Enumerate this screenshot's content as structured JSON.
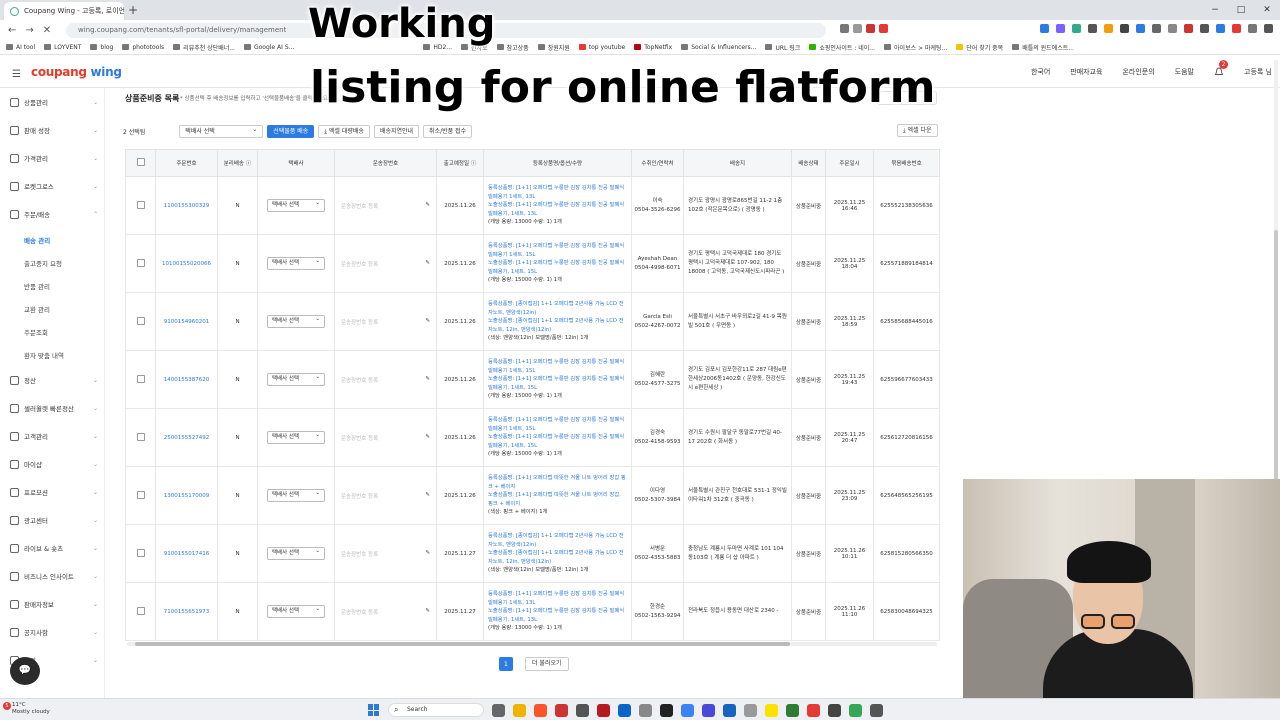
{
  "browser": {
    "tab_title": "Coupang Wing - 고등록, 로이언",
    "tab_close": "×",
    "new_tab": "+",
    "address": "wing.coupang.com/tenants/sfl-portal/delivery/management",
    "nav": [
      "←",
      "→",
      "✕"
    ],
    "window_controls": [
      "−",
      "□",
      "✕"
    ],
    "bookmarks": [
      "AI tool",
      "LOYVENT",
      "blog",
      "phototools",
      "리뷰추천 상단배너...",
      "Google AI S...",
      "HD2...",
      "한자로",
      "참고상품",
      "창원지원",
      "top youtube",
      "TopNetfix",
      "Social & Influencers...",
      "URL 링크",
      "쇼핑인사이트 : 네이...",
      "아이보스 > 마케팅...",
      "단어 찾기 중복",
      "배틀의 윈드에스트..."
    ]
  },
  "app": {
    "menu_icon": "☰",
    "logo_a": "coupang",
    "logo_b": "wing",
    "header_right": [
      "한국어",
      "판매자교육",
      "온라인문의",
      "도움말"
    ],
    "notification_count": "2",
    "user": "고등록 님"
  },
  "sidebar": {
    "items": [
      {
        "label": "상품관리"
      },
      {
        "label": "판매 성장"
      },
      {
        "label": "가격관리"
      },
      {
        "label": "로켓그로스"
      },
      {
        "label": "주문/배송"
      },
      {
        "label": "정산"
      },
      {
        "label": "셀러월렛 빠른정산"
      },
      {
        "label": "고객관리"
      },
      {
        "label": "마이샵"
      },
      {
        "label": "프로모션"
      },
      {
        "label": "광고센터"
      },
      {
        "label": "라이브 & 숏츠"
      },
      {
        "label": "비즈니스 인사이트"
      },
      {
        "label": "판매자정보"
      },
      {
        "label": "공지사항"
      },
      {
        "label": "문의"
      }
    ],
    "subitems": [
      "배송 관리",
      "출고중지 요청",
      "반품 관리",
      "교환 관리",
      "주문조회",
      "환자 맞춤 내역"
    ],
    "chat_icon": "💬"
  },
  "main": {
    "title": "상품준비중 목록",
    "description": "* 상품선택 후 배송정보를 입력하고 '선택물품배송'을 클릭하세요.",
    "close_label": "기",
    "selected_count": "2 선택됨",
    "carrier_select": "택배사 선택",
    "buttons": [
      "선택물품 배송",
      "⤓ 엑셀 대량배송",
      "배송지연안내",
      "취소/반품 접수"
    ],
    "excel_download": "⤓ 엑셀 다운",
    "columns": [
      "",
      "주문번호",
      "분리배송 ⓘ",
      "택배사",
      "운송장번호",
      "출고예정일 ⓘ",
      "등록상품명/옵션/수량",
      "수취인/연락처",
      "배송지",
      "배송상태",
      "주문일시",
      "묶음배송번호"
    ],
    "tracking_placeholder": "운송장번호 등록",
    "pen_icon": "✎",
    "rows": [
      {
        "order_no": "1100155300329",
        "split": "N",
        "carrier": "택배사 선택",
        "ship_date": "2025.11.26",
        "product": "등록상품명: [1+1] 오메다랩 누룽판 김장 김치통 진공 밀폐식 밀폐용기 1세트, 13L",
        "exposure": "노출상품명: [1+1] 오메다랩 누룽판 김장 김치통 진공 밀폐식 밀폐용기, 1세트, 13L",
        "option": "(개당 용량: 13000 수량: 1) 1개",
        "receiver": "이숙",
        "phone": "0504-3526-6296",
        "address": "경기도 광명시 광명로865번길 11-2 1층 102호 (작은문목으로) ( 광명동 )",
        "status": "상품준비중",
        "order_time": "2025.11.25 16:46",
        "bundle_no": "625552138305636"
      },
      {
        "order_no": "10100155020066",
        "split": "N",
        "carrier": "택배사 선택",
        "ship_date": "2025.11.26",
        "product": "등록상품명: [1+1] 오메다랩 누룽판 김장 김치통 진공 밀폐식 밀폐용기 1세트, 15L",
        "exposure": "노출상품명: [1+1] 오메다랩 누룽판 김장 김치통 진공 밀폐식 밀폐용기, 1세트, 15L",
        "option": "(개당 용량: 15000 수량: 1) 1개",
        "receiver": "Ayeshah Dean",
        "phone": "0504-4998-6071",
        "address": "경기도 평택시 고덕국제대로 180 경기도 평택시 고덕국제대로 107-902, 180 18008 ( 고덕동, 고덕국제신도시파라곤 )",
        "status": "상품준비중",
        "order_time": "2025.11.25 18:04",
        "bundle_no": "625571889184814"
      },
      {
        "order_no": "9100154960201",
        "split": "N",
        "carrier": "택배사 선택",
        "ship_date": "2025.11.26",
        "product": "등록상품명: [종이접김] 1+1 오메다랩 2년사용 가능 LCD 전자노트, 맨양색(12in)",
        "exposure": "노출상품명: [종이접김] 1+1 오메다랩 2년사용 가능 LCD 전자노트, 12in, 맨양색(12in)",
        "option": "(색상: 맨양색(12in) 모델명/품번: 12in) 1개",
        "receiver": "Garcia Esli",
        "phone": "0502-4267-0072",
        "address": "서울특별시 서초구 바우뫼로2길 41-9 목원빌 501호 ( 우면동 )",
        "status": "상품준비중",
        "order_time": "2025.11.25 18:59",
        "bundle_no": "625585688445016"
      },
      {
        "order_no": "1400155387620",
        "split": "N",
        "carrier": "택배사 선택",
        "ship_date": "2025.11.26",
        "product": "등록상품명: [1+1] 오메다랩 누룽판 김장 김치통 진공 밀폐식 밀폐용기 1세트, 15L",
        "exposure": "노출상품명: [1+1] 오메다랩 누룽판 김장 김치통 진공 밀폐식 밀폐용기, 1세트, 15L",
        "option": "(개당 용량: 15000 수량: 1) 1개",
        "receiver": "김혜란",
        "phone": "0502-4577-3275",
        "address": "경기도 김포시 김포한강11로 287 대림e편한세상2006동1402호 ( 운양동, 한강신도시 e편한세상 )",
        "status": "상품준비중",
        "order_time": "2025.11.25 19:43",
        "bundle_no": "625596677603433"
      },
      {
        "order_no": "2500155527492",
        "split": "N",
        "carrier": "택배사 선택",
        "ship_date": "2025.11.26",
        "product": "등록상품명: [1+1] 오메다랩 누룽판 김장 김치통 진공 밀폐식 밀폐용기 1세트, 15L",
        "exposure": "노출상품명: [1+1] 오메다랩 누룽판 김장 김치통 진공 밀폐식 밀폐용기, 1세트, 15L",
        "option": "(개당 용량: 15000 수량: 1) 1개",
        "receiver": "김경숙",
        "phone": "0502-4158-9593",
        "address": "경기도 수원시 팔달구 동말로77번길 40-17 202호 ( 화서동 )",
        "status": "상품준비중",
        "order_time": "2025.11.25 20:47",
        "bundle_no": "625612720816156"
      },
      {
        "order_no": "1300155170009",
        "split": "N",
        "carrier": "택배사 선택",
        "ship_date": "2025.11.26",
        "product": "등록상품명: [1+1] 오메다랩 따뜻한 겨울 니트 벙어리 장갑 핑크 + 베이지",
        "exposure": "노출상품명: [1+1] 오메다랩 따뜻한 겨울 니트 벙어리 장갑, 핑크 + 베이지",
        "option": "(색상: 핑크 + 베이지) 1개",
        "receiver": "이다영",
        "phone": "0502-5307-3984",
        "address": "서울특별시 관진구 천호대로 531-1 정익빌이타워1차 312호 ( 중곡동 )",
        "status": "상품준비중",
        "order_time": "2025.11.25 23:09",
        "bundle_no": "625648565256195"
      },
      {
        "order_no": "9100155017416",
        "split": "N",
        "carrier": "택배사 선택",
        "ship_date": "2025.11.27",
        "product": "등록상품명: [종이접김] 1+1 오메다랩 2년사용 가능 LCD 전자노트, 맨양색(12in)",
        "exposure": "노출상품명: [종이접김] 1+1 오메다랩 2년사용 가능 LCD 전자노트, 12in, 맨양색(12in)",
        "option": "(색상: 맨양색(12in) 모델명/품번: 12in) 1개",
        "receiver": "서병문",
        "phone": "0502-4353-5883",
        "address": "충청남도 계룡시 두마면 사계로 101 104동103호 ( 계룡 더 샵 아파트 )",
        "status": "상품준비중",
        "order_time": "2025.11.26 10:11",
        "bundle_no": "625815280566350"
      },
      {
        "order_no": "7100155651973",
        "split": "N",
        "carrier": "택배사 선택",
        "ship_date": "2025.11.27",
        "product": "등록상품명: [1+1] 오메다랩 누룽판 김장 김치통 진공 밀폐식 밀폐용기 1세트, 13L",
        "exposure": "노출상품명: [1+1] 오메다랩 누룽판 김장 김치통 진공 밀폐식 밀폐용기, 1세트, 13L",
        "option": "(개당 용량: 13000 수량: 1) 1개",
        "receiver": "한경순",
        "phone": "0502-1563-9294",
        "address": "전라북도 정읍시 용동면 대산로 2340 -",
        "status": "상품준비중",
        "order_time": "2025.11.26 11:10",
        "bundle_no": "625830048694325"
      }
    ],
    "page": "1",
    "load_more": "더 불러오기"
  },
  "overlay": {
    "line1": "Working",
    "line2": "listing for online flatform"
  },
  "taskbar": {
    "weather_temp": "11°C",
    "weather_desc": "Mostly cloudy",
    "weather_badge": "5",
    "search": "Search"
  },
  "colors": {
    "accent": "#2c7be0",
    "logo_red": "#e8392c",
    "badge": "#e53935"
  }
}
